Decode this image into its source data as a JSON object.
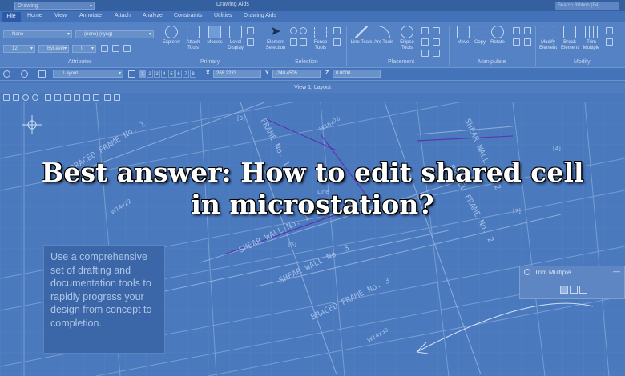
{
  "titlebar": {
    "workflow": "Drawing",
    "app_title": "Drawing Aids",
    "search_placeholder": "Search Ribbon (F4)"
  },
  "tabs": [
    "File",
    "Home",
    "View",
    "Annotate",
    "Attach",
    "Analyze",
    "Constraints",
    "Utilities",
    "Drawing Aids"
  ],
  "ribbon": {
    "level_combo": "None",
    "style_combo": "(none) (sysg)",
    "weight_combo": "12",
    "color_combo": "ByLevel",
    "lineweight_combo": "0",
    "primary_buttons": [
      {
        "label": "Explorer"
      },
      {
        "label": "Attach Tools"
      },
      {
        "label": "Models"
      },
      {
        "label": "Level Display"
      }
    ],
    "selection_buttons": [
      {
        "label": "Element Selection"
      },
      {
        "label": "Fence Tools"
      }
    ],
    "placement_buttons": [
      {
        "label": "Line Tools"
      },
      {
        "label": "Arc Tools"
      },
      {
        "label": "Ellipse Tools"
      }
    ],
    "manipulate_buttons": [
      {
        "label": "Move"
      },
      {
        "label": "Copy"
      },
      {
        "label": "Rotate"
      }
    ],
    "modify_buttons": [
      {
        "label": "Modify Element"
      },
      {
        "label": "Break Element"
      },
      {
        "label": "Trim Multiple"
      }
    ],
    "groups": [
      "Attributes",
      "Primary",
      "Selection",
      "Placement",
      "Manipulate",
      "Modify"
    ]
  },
  "accudraw": {
    "layout_label": "Layout",
    "views": [
      "1",
      "2",
      "3",
      "4",
      "5",
      "6",
      "7",
      "8"
    ],
    "x_label": "X",
    "x_value": "268.2233",
    "y_label": "Y",
    "y_value": "-240.4505",
    "z_label": "Z",
    "z_value": "0.0000"
  },
  "view_title": "View 1, Layout",
  "headline": "Best answer: How to edit shared cell in microstation?",
  "promo": "Use a comprehensive set of drafting and documentation tools to rapidly progress your design from concept to completion.",
  "trim_panel": {
    "title": "Trim Multiple",
    "minimize": "—"
  },
  "drawing_labels": [
    "BRACED FRAME No. 1",
    "BRACED FRAME No. 2",
    "BRACED FRAME No. 3",
    "SHEAR WALL No. 1",
    "SHEAR WALL No. 2",
    "SHEAR WALL No. 3",
    "FRAME No. 1",
    "W16x26",
    "W14x22",
    "W14x30",
    "Line",
    "[3]",
    "[4]",
    "[5]",
    "[7]"
  ]
}
